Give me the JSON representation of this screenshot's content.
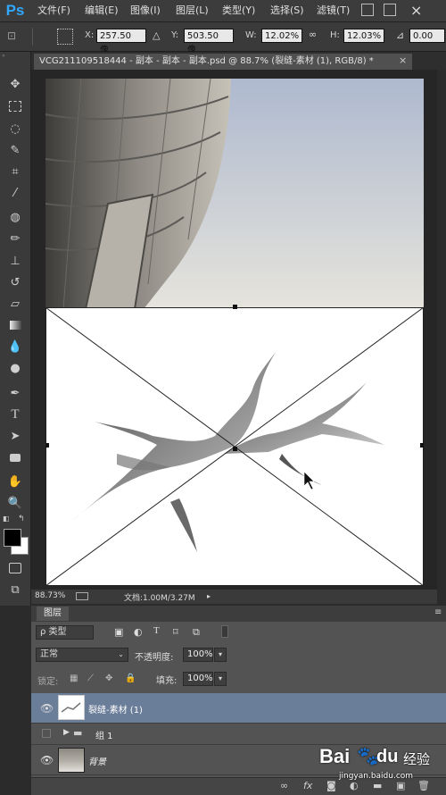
{
  "app": {
    "logo": "Ps"
  },
  "menu": [
    "文件(F)",
    "编辑(E)",
    "图像(I)",
    "图层(L)",
    "类型(Y)",
    "选择(S)",
    "滤镜(T)"
  ],
  "options": {
    "x_label": "X:",
    "x_value": "257.50 像",
    "y_label": "Y:",
    "y_value": "503.50 像",
    "w_label": "W:",
    "w_value": "12.02%",
    "h_label": "H:",
    "h_value": "12.03%",
    "angle_value": "0.00"
  },
  "document": {
    "tab_title": "VCG211109518444 - 副本 - 副本 - 副本.psd @ 88.7% (裂缝-素材 (1), RGB/8) *",
    "close_glyph": "×"
  },
  "status": {
    "zoom": "88.73%",
    "doc_size": "文档:1.00M/3.27M"
  },
  "layers_panel": {
    "title": "图层",
    "filter_kind": "ρ 类型",
    "blend_mode": "正常",
    "opacity_label": "不透明度:",
    "opacity_value": "100%",
    "lock_label": "锁定:",
    "fill_label": "填充:",
    "fill_value": "100%",
    "layers": [
      {
        "name": "裂缝-素材 (1)",
        "selected": true,
        "visible": true,
        "type": "smart-object"
      },
      {
        "name": "组 1",
        "selected": false,
        "visible": false,
        "type": "group"
      },
      {
        "name": "背景",
        "selected": false,
        "visible": true,
        "type": "image"
      }
    ]
  },
  "watermark": {
    "brand": "Bai",
    "brand2": "du",
    "sub": "经验",
    "url": "jingyan.baidu.com"
  },
  "colors": {
    "selected_layer": "#6a7d99",
    "panel_bg": "#535353",
    "ps_blue": "#31a8ff"
  }
}
